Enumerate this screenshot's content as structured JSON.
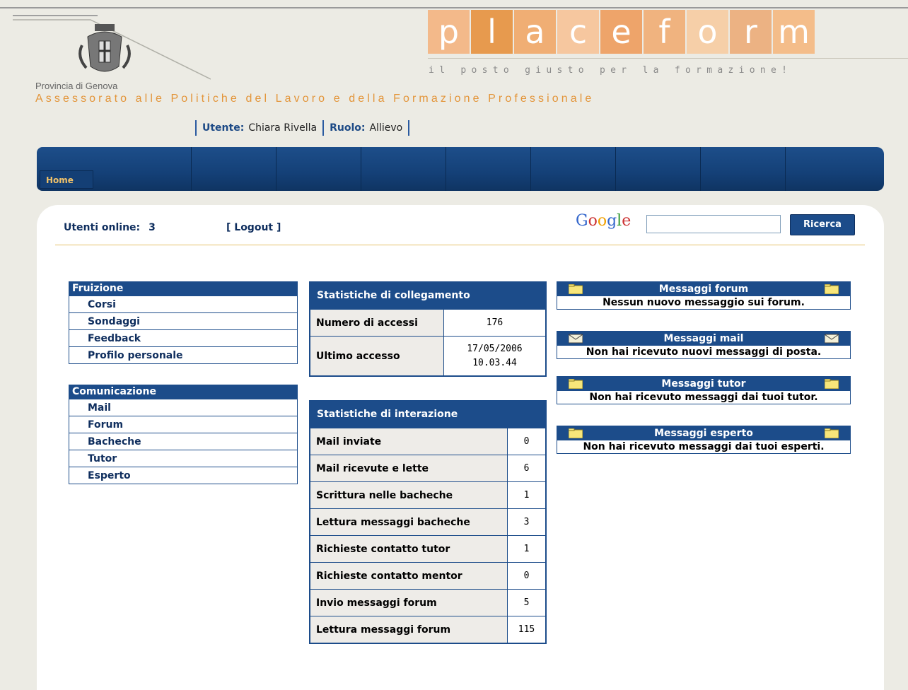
{
  "header": {
    "province": "Provincia di Genova",
    "subtitle": "Assessorato alle Politiche del Lavoro e della Formazione Professionale",
    "logo_letters": [
      "p",
      "l",
      "a",
      "c",
      "e",
      "f",
      "o",
      "r",
      "m"
    ],
    "logo_colors": [
      "#f3b98a",
      "#e79a4e",
      "#f0ae74",
      "#f6c79f",
      "#eea46a",
      "#f0b37f",
      "#f6cfa8",
      "#ecb283",
      "#f4bd8a"
    ],
    "tagline": "il posto giusto per la formazione!"
  },
  "userbar": {
    "user_label": "Utente:",
    "user_value": "Chiara Rivella",
    "role_label": "Ruolo:",
    "role_value": "Allievo"
  },
  "nav": {
    "home": "Home"
  },
  "toolbar": {
    "online_label": "Utenti online:",
    "online_count": "3",
    "logout": "[ Logout ]",
    "google": "Google",
    "search_placeholder": "",
    "search_button": "Ricerca"
  },
  "menus": [
    {
      "title": "Fruizione",
      "items": [
        "Corsi",
        "Sondaggi",
        "Feedback",
        "Profilo personale"
      ]
    },
    {
      "title": "Comunicazione",
      "items": [
        "Mail",
        "Forum",
        "Bacheche",
        "Tutor",
        "Esperto"
      ]
    }
  ],
  "stats_connection": {
    "title": "Statistiche di collegamento",
    "rows": [
      {
        "label": "Numero di accessi",
        "value": "176"
      },
      {
        "label": "Ultimo accesso",
        "value": "17/05/2006",
        "value2": "10.03.44"
      }
    ]
  },
  "stats_interaction": {
    "title": "Statistiche di interazione",
    "rows": [
      {
        "label": "Mail inviate",
        "value": "0"
      },
      {
        "label": "Mail ricevute e lette",
        "value": "6"
      },
      {
        "label": "Scrittura nelle bacheche",
        "value": "1"
      },
      {
        "label": "Lettura messaggi bacheche",
        "value": "3"
      },
      {
        "label": "Richieste contatto tutor",
        "value": "1"
      },
      {
        "label": "Richieste contatto mentor",
        "value": "0"
      },
      {
        "label": "Invio messaggi forum",
        "value": "5"
      },
      {
        "label": "Lettura messaggi forum",
        "value": "115"
      }
    ]
  },
  "messages": [
    {
      "title": "Messaggi forum",
      "text": "Nessun nuovo messaggio sui forum.",
      "icon": "folder-icon"
    },
    {
      "title": "Messaggi mail",
      "text": "Non hai ricevuto nuovi messaggi di posta.",
      "icon": "envelope-icon"
    },
    {
      "title": "Messaggi tutor",
      "text": "Non hai ricevuto messaggi dai tuoi tutor.",
      "icon": "folder-icon"
    },
    {
      "title": "Messaggi esperto",
      "text": "Non hai ricevuto messaggi dai tuoi esperti.",
      "icon": "folder-icon"
    }
  ]
}
